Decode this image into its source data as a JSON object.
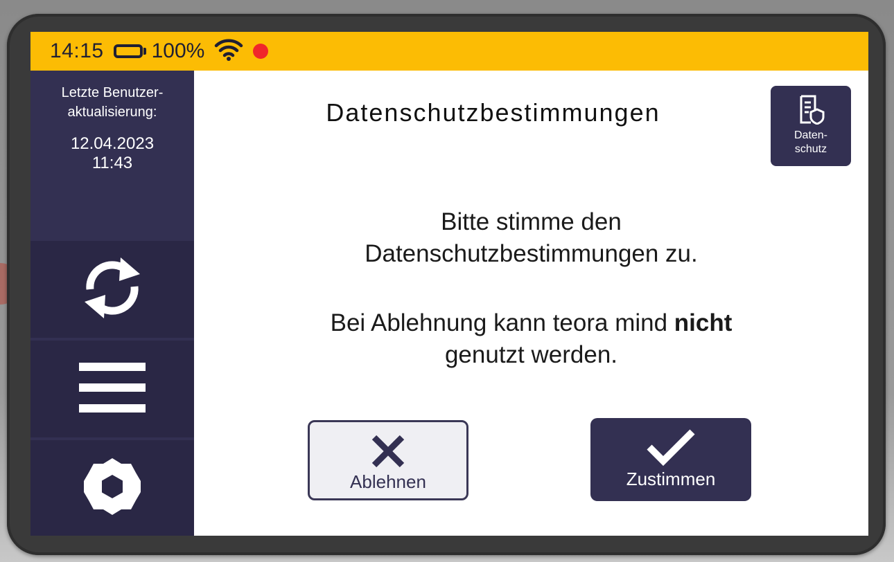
{
  "status_bar": {
    "time": "14:15",
    "battery_percent": "100%",
    "battery_level": 1.0,
    "wifi_icon": "wifi-icon",
    "recording_indicator_color": "#f0262a",
    "background_color": "#fcbc04"
  },
  "sidebar": {
    "update_label": "Letzte Benutzer-aktualisierung:",
    "update_label_line1": "Letzte Benutzer-",
    "update_label_line2": "aktualisierung:",
    "update_date": "12.04.2023",
    "update_time": "11:43",
    "buttons": [
      {
        "icon": "sync-icon"
      },
      {
        "icon": "menu-icon"
      },
      {
        "icon": "settings-icon"
      }
    ]
  },
  "main": {
    "title": "Datenschutzbestimmungen",
    "privacy_button": {
      "icon": "privacy-document-icon",
      "label_line1": "Daten-",
      "label_line2": "schutz"
    },
    "message_1_line1": "Bitte stimme den",
    "message_1_line2": "Datenschutzbestimmungen zu.",
    "message_2_prefix": "Bei Ablehnung kann teora mind ",
    "message_2_bold": "nicht",
    "message_2_line2": "genutzt werden.",
    "decline_label": "Ablehnen",
    "accept_label": "Zustimmen"
  },
  "colors": {
    "primary": "#333052",
    "accent": "#fcbc04",
    "battery_fill": "#69c13a"
  }
}
